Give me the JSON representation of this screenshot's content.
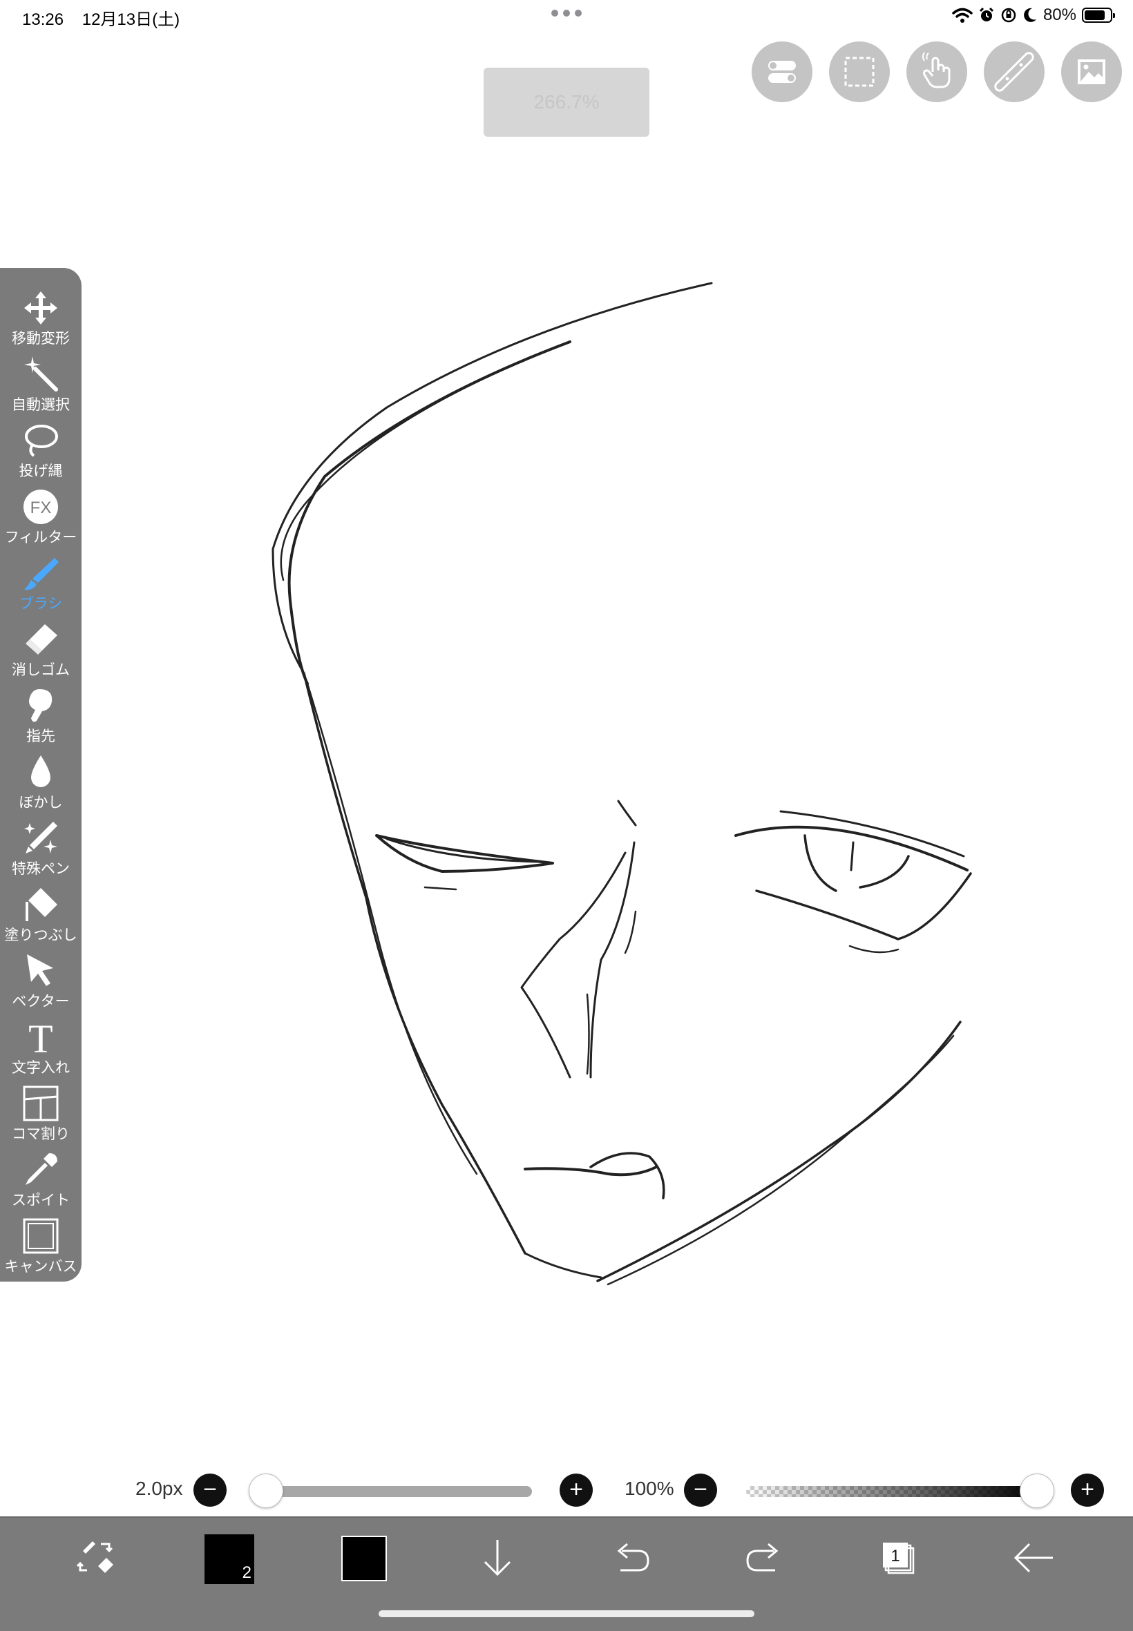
{
  "status_bar": {
    "time": "13:26",
    "date": "12月13日(土)",
    "battery_text": "80%",
    "battery_level": 0.8,
    "icons": [
      "wifi-icon",
      "alarm-icon",
      "orientation-lock-icon",
      "moon-icon",
      "battery-icon"
    ]
  },
  "zoom_indicator": "266.7%",
  "top_buttons": [
    {
      "name": "toggle-icon"
    },
    {
      "name": "selection-icon"
    },
    {
      "name": "touch-icon"
    },
    {
      "name": "ruler-icon"
    },
    {
      "name": "material-icon"
    }
  ],
  "tools": [
    {
      "label": "移動変形",
      "icon": "move-icon",
      "active": false
    },
    {
      "label": "自動選択",
      "icon": "magic-wand-icon",
      "active": false
    },
    {
      "label": "投げ縄",
      "icon": "lasso-icon",
      "active": false
    },
    {
      "label": "フィルター",
      "icon": "filter-fx-icon",
      "active": false
    },
    {
      "label": "ブラシ",
      "icon": "brush-icon",
      "active": true
    },
    {
      "label": "消しゴム",
      "icon": "eraser-icon",
      "active": false
    },
    {
      "label": "指先",
      "icon": "finger-icon",
      "active": false
    },
    {
      "label": "ぼかし",
      "icon": "blur-drop-icon",
      "active": false
    },
    {
      "label": "特殊ペン",
      "icon": "special-pen-icon",
      "active": false
    },
    {
      "label": "塗りつぶし",
      "icon": "fill-bucket-icon",
      "active": false
    },
    {
      "label": "ベクター",
      "icon": "vector-cursor-icon",
      "active": false
    },
    {
      "label": "文字入れ",
      "icon": "text-icon",
      "active": false
    },
    {
      "label": "コマ割り",
      "icon": "panel-icon",
      "active": false
    },
    {
      "label": "スポイト",
      "icon": "eyedropper-icon",
      "active": false
    },
    {
      "label": "キャンバス",
      "icon": "canvas-icon",
      "active": false
    }
  ],
  "brush_size": {
    "label": "2.0px",
    "minus": "−",
    "plus": "+",
    "level": 0.0
  },
  "opacity": {
    "label": "100%",
    "minus": "−",
    "plus": "+",
    "level": 1.0
  },
  "bottom_bar": {
    "primary_color": "#000000",
    "primary_color_badge": "2",
    "secondary_color": "#000000",
    "layer_count": "1",
    "icons": [
      "swap-brush-eraser-icon",
      "download-icon",
      "undo-icon",
      "redo-icon",
      "layers-icon",
      "back-arrow-icon"
    ]
  },
  "colors": {
    "toolbar_bg": "#7b7b7b",
    "active_tool": "#4aa8ff",
    "round_button": "#c4c4c4"
  }
}
